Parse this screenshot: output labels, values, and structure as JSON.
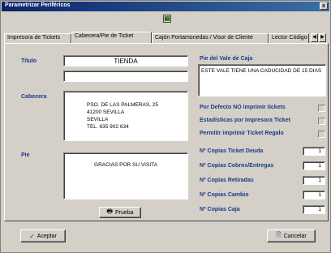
{
  "window": {
    "title": "Parametrizar Periféricos",
    "close_glyph": "x"
  },
  "toolbar": {
    "icon": "document-icon"
  },
  "tabs": [
    {
      "label": "Impresora de Tickets"
    },
    {
      "label": "Cabecera/Pie de Ticket",
      "active": true
    },
    {
      "label": "Cajón Portamonedas / Visor de Cliente"
    },
    {
      "label": "Lector Código"
    }
  ],
  "form": {
    "titulo_label": "Título",
    "titulo_value": "TIENDA",
    "titulo2_value": "",
    "cabecera_label": "Cabecera",
    "cabecera_value": "PSO. DE LAS PALMERAS, 25\n41200 SEVILLA\nSEVILLA\nTEL. 635 902 634",
    "pie_label": "Pie",
    "pie_value": "GRACIAS POR SU VISITA",
    "prueba_label": "Prueba",
    "pie_vale_label": "Pie del Vale de Caja",
    "pie_vale_value": "ESTE VALE TIENE UNA CADUCIDAD DE 15 DIAS",
    "options": [
      {
        "label": "Por Defecto NO imprimir tickets",
        "checked": false
      },
      {
        "label": "Estadísticas por Impresora Ticket",
        "checked": false
      },
      {
        "label": "Permitir imprimir Ticket Regalo",
        "checked": false
      }
    ],
    "copies": [
      {
        "label": "Nº Copias Ticket Deuda",
        "value": "1"
      },
      {
        "label": "Nº Copias Cobros/Entregas",
        "value": "1"
      },
      {
        "label": "Nº Copias Retiradas",
        "value": "1"
      },
      {
        "label": "Nº Copias Cambio",
        "value": "1"
      },
      {
        "label": "Nº Copias Caja",
        "value": "1"
      }
    ]
  },
  "footer": {
    "accept_label": "Aceptar",
    "cancel_label": "Cancelar"
  }
}
